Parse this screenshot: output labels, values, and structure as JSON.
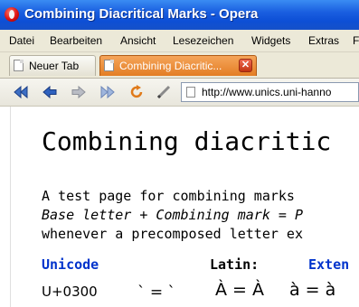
{
  "window": {
    "title": "Combining Diacritical Marks - Opera",
    "icon": "opera-logo-icon"
  },
  "menu": [
    "Datei",
    "Bearbeiten",
    "Ansicht",
    "Lesezeichen",
    "Widgets",
    "Extras",
    "F"
  ],
  "tabs": [
    {
      "label": "Neuer Tab",
      "icon": "page-icon",
      "active": false
    },
    {
      "label": "Combining Diacritic...",
      "icon": "page-icon",
      "active": true
    }
  ],
  "tab_close_glyph": "✕",
  "toolbar": {
    "buttons": [
      "rewind-icon",
      "back-icon",
      "forward-icon",
      "fast-forward-icon",
      "reload-icon",
      "edit-icon"
    ],
    "address": "http://www.unics.uni-hanno"
  },
  "page": {
    "heading": "Combining diacritic",
    "intro": [
      "A test page for combining marks",
      "Base letter + Combining mark = P",
      "whenever a precomposed letter ex"
    ],
    "table_headers": [
      "Unicode",
      "Latin:",
      "Exten"
    ],
    "row": {
      "code": "U+0300",
      "mark": "` = `",
      "upper": "À = À",
      "lower": "à = à"
    }
  },
  "colors": {
    "titlebar": "#0d4fd6",
    "tab_active": "#e37d24",
    "link_blue": "#0033cc",
    "chrome": "#ece9d8"
  }
}
